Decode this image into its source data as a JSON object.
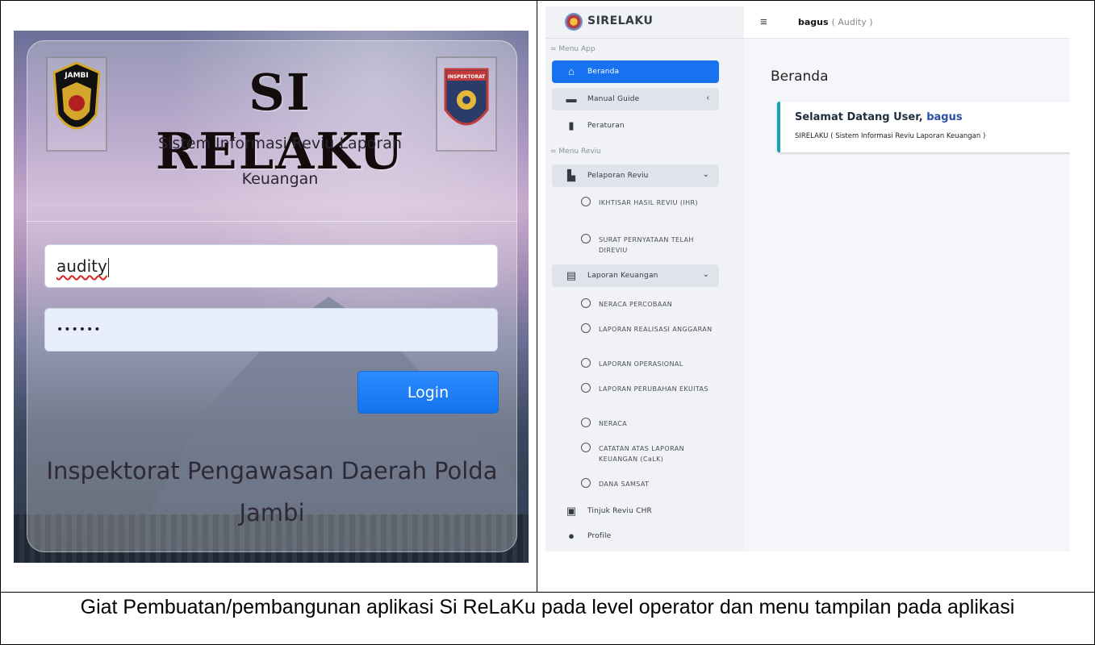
{
  "login": {
    "app_title": "SI RELAKU",
    "subtitle": "Sistem Informasi Reviu Laporan Keuangan",
    "badge_left_text": "JAMBI",
    "badge_right_text": "INSPEKTORAT",
    "username_value": "audity",
    "password_value": "••••••",
    "login_button": "Login",
    "org_name": "Inspektorat Pengawasan Daerah Polda Jambi"
  },
  "dashboard": {
    "brand": "SIRELAKU",
    "topbar": {
      "menu_icon": "hamburger-icon",
      "username": "bagus",
      "role": "( Audity )"
    },
    "page_heading": "Beranda",
    "welcome": {
      "title_prefix": "Selamat Datang User,",
      "username": "bagus",
      "description": "SIRELAKU ( Sistem Informasi Reviu Laporan Keuangan )"
    },
    "sidebar": {
      "header_app": "= Menu App",
      "header_reviu": "= Menu Reviu",
      "beranda": "Beranda",
      "manual_guide": "Manual Guide",
      "peraturan": "Peraturan",
      "pelaporan_reviu": "Pelaporan Reviu",
      "pelaporan_items": [
        "IKHTISAR HASIL REVIU (IHR)",
        "SURAT PERNYATAAN TELAH DIREVIU"
      ],
      "laporan_keuangan": "Laporan Keuangan",
      "laporan_items": [
        "NERACA PERCOBAAN",
        "LAPORAN REALISASI ANGGARAN",
        "LAPORAN OPERASIONAL",
        "LAPORAN PERUBAHAN EKUITAS",
        "NERACA",
        "CATATAN ATAS LAPORAN KEUANGAN (CaLK)",
        "DANA SAMSAT"
      ],
      "tinjuk_reviu": "Tinjuk Reviu CHR",
      "profile": "Profile"
    }
  },
  "caption": "Giat Pembuatan/pembangunan aplikasi Si ReLaKu pada level operator dan menu tampilan pada aplikasi"
}
